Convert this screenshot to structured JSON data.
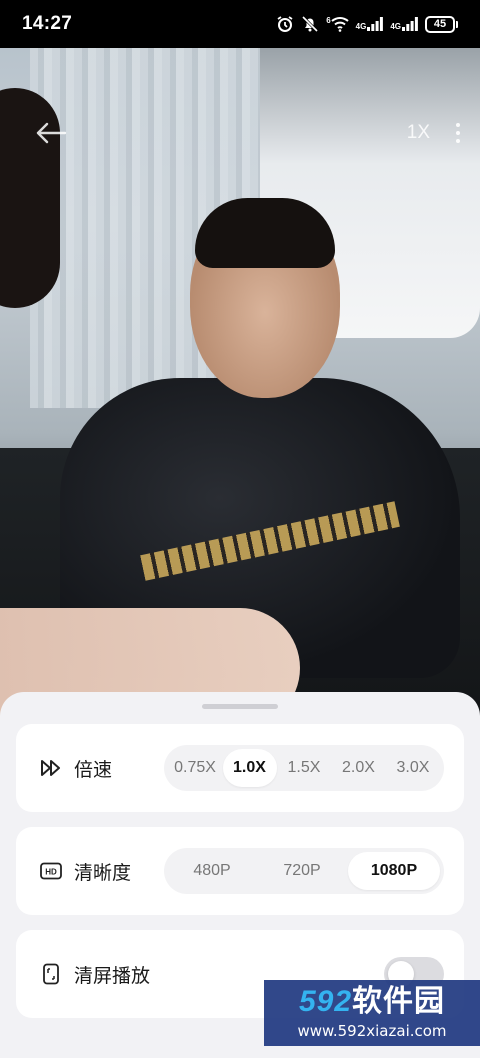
{
  "status_bar": {
    "time": "14:27",
    "network_1": "4G",
    "network_2": "4G",
    "wifi_label": "6",
    "battery": "45",
    "icons": [
      "alarm-icon",
      "mute-icon",
      "wifi-icon",
      "signal-icon",
      "signal-icon",
      "battery-icon"
    ]
  },
  "video": {
    "speed_indicator": "1X",
    "icons": [
      "back-arrow-icon",
      "more-vertical-icon"
    ]
  },
  "sheet": {
    "speed": {
      "label": "倍速",
      "icon": "fast-forward-icon",
      "options": [
        "0.75X",
        "1.0X",
        "1.5X",
        "2.0X",
        "3.0X"
      ],
      "selected": "1.0X"
    },
    "quality": {
      "label": "清晰度",
      "icon": "hd-icon",
      "options": [
        "480P",
        "720P",
        "1080P"
      ],
      "selected": "1080P"
    },
    "clean_mode": {
      "label": "清屏播放",
      "icon": "phone-frame-icon",
      "enabled": false
    }
  },
  "watermark": {
    "main_num": "592",
    "main_text": "软件园",
    "sub": "www.592xiazai.com"
  },
  "colors": {
    "sheet_bg": "#f2f2f5",
    "card_bg": "#ffffff",
    "segment_bg": "#f2f2f4",
    "watermark_bg": "#203880",
    "watermark_accent": "#34b3f0"
  }
}
